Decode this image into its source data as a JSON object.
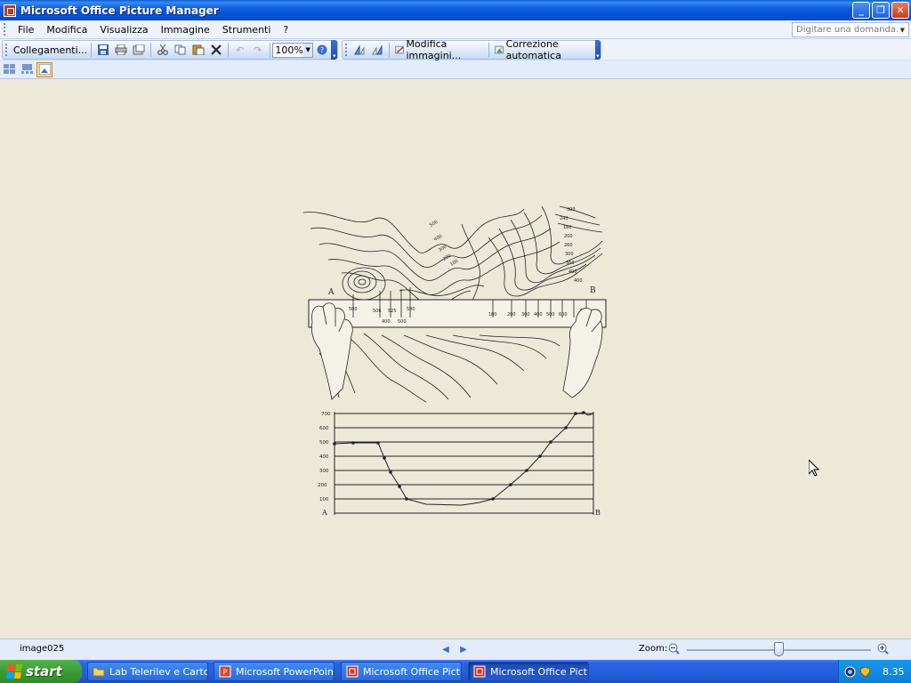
{
  "window": {
    "title": "Microsoft Office Picture Manager",
    "controls": {
      "minimize": "_",
      "restore": "❐",
      "close": "✕"
    }
  },
  "menu": {
    "items": [
      {
        "label": "File",
        "accel": "F"
      },
      {
        "label": "Modifica",
        "accel": "M"
      },
      {
        "label": "Visualizza",
        "accel": "V"
      },
      {
        "label": "Immagine",
        "accel": "I"
      },
      {
        "label": "Strumenti",
        "accel": "S"
      },
      {
        "label": "?",
        "accel": "?"
      }
    ],
    "ask_placeholder": "Digitare una domanda."
  },
  "toolbar": {
    "shortcuts_label": "Collegamenti...",
    "zoom_value": "100%",
    "edit_pictures_label": "Modifica immagini...",
    "auto_correct_label": "Correzione automatica"
  },
  "picture": {
    "map_labels": {
      "a": "A",
      "b": "B"
    },
    "contour_labels": [
      "500",
      "400",
      "300",
      "200",
      "100",
      "300",
      "240",
      "180",
      "200",
      "260",
      "300",
      "360",
      "400",
      "400"
    ],
    "ruler_labels_left": [
      "500",
      "506",
      "525",
      "580"
    ],
    "ruler_labels_left_below": [
      "400",
      "500"
    ],
    "ruler_labels_right": [
      "180",
      "200",
      "300",
      "400",
      "500",
      "600",
      "700"
    ],
    "profile_axis": [
      "700",
      "600",
      "500",
      "400",
      "300",
      "200",
      "100"
    ],
    "profile_labels": {
      "a": "A",
      "b": "B"
    }
  },
  "status": {
    "file_name": "image025",
    "zoom_label": "Zoom:",
    "zoom_level": 0.5
  },
  "taskbar": {
    "start_label": "start",
    "tasks": [
      {
        "label": "Lab Telerilev e Carto...",
        "icon": "folder-icon",
        "active": false
      },
      {
        "label": "Microsoft PowerPoint ...",
        "icon": "powerpoint-icon",
        "active": false
      },
      {
        "label": "Microsoft Office Pictu...",
        "icon": "picture-manager-icon",
        "active": false
      },
      {
        "label": "Microsoft Office Pictu...",
        "icon": "picture-manager-icon",
        "active": true
      }
    ],
    "clock": "8.35"
  }
}
